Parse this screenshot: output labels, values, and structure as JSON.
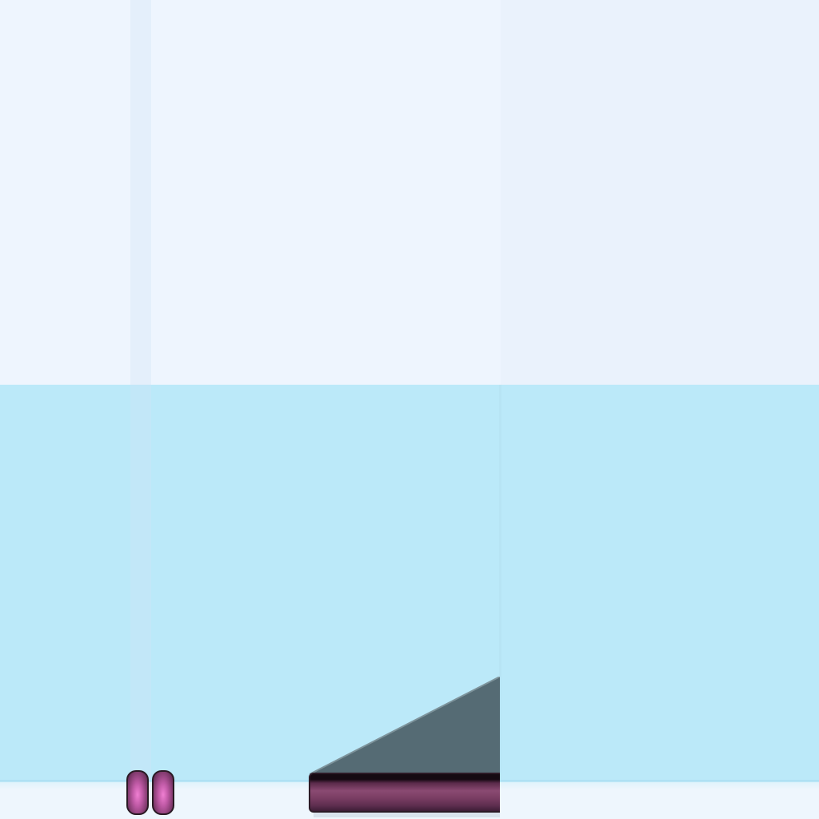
{
  "scene": {
    "name": "platformer-level",
    "colors": {
      "sky": "#eef5fe",
      "water": "#bbe9f9",
      "ground": "#eef6fd",
      "ramp": "#556b74",
      "platform": "#7a3d63",
      "pill": "#c05aa6"
    }
  },
  "objects": {
    "pills": [
      {
        "icon": "pink-capsule-icon"
      },
      {
        "icon": "pink-capsule-icon"
      }
    ],
    "ramp": {
      "icon": "slate-ramp-triangle"
    },
    "platform": {
      "icon": "maroon-bar-platform"
    }
  }
}
